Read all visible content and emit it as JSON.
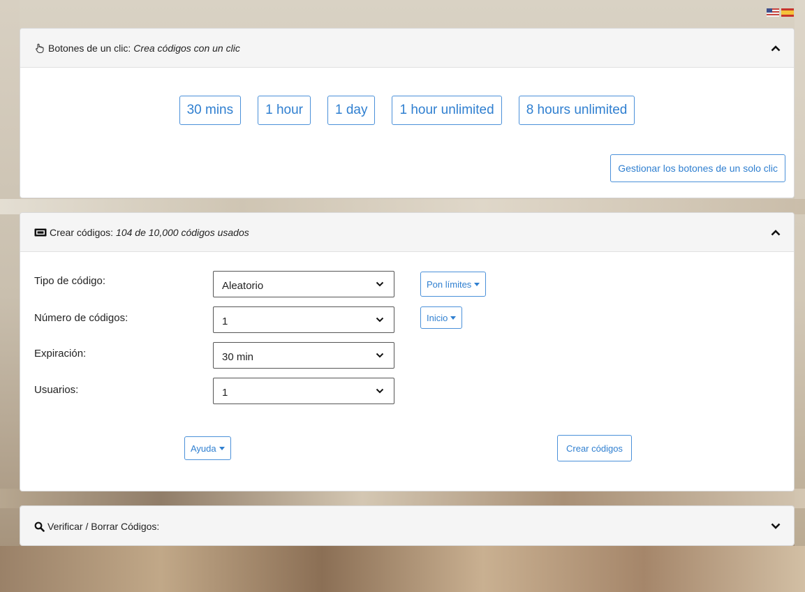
{
  "languages": [
    "us-flag-icon",
    "es-flag-icon"
  ],
  "oneclick": {
    "icon": "pointer-hand-icon",
    "title": "Botones de un clic:",
    "subtitle": "Crea códigos con un clic",
    "buttons": [
      "30 mins",
      "1 hour",
      "1 day",
      "1 hour unlimited",
      "8 hours unlimited"
    ],
    "manage_label": "Gestionar los botones de un solo clic",
    "collapse_icon": "chevron-up-icon"
  },
  "create": {
    "icon": "ticket-icon",
    "title": "Crear códigos:",
    "subtitle": "104 de 10,000 códigos usados",
    "collapse_icon": "chevron-up-icon",
    "fields": {
      "code_type": {
        "label": "Tipo de código:",
        "value": "Aleatorio"
      },
      "code_count": {
        "label": "Número de códigos:",
        "value": "1"
      },
      "expiration": {
        "label": "Expiración:",
        "value": "30 min"
      },
      "users": {
        "label": "Usuarios:",
        "value": "1"
      }
    },
    "limits_label": "Pon límites",
    "start_label": "Inicio",
    "help_label": "Ayuda",
    "submit_label": "Crear códigos"
  },
  "verify": {
    "icon": "search-icon",
    "title": "Verificar / Borrar Códigos:",
    "expand_icon": "chevron-down-icon"
  },
  "colors": {
    "accent": "#2f7fd0",
    "panel_header": "#f5f5f5"
  }
}
